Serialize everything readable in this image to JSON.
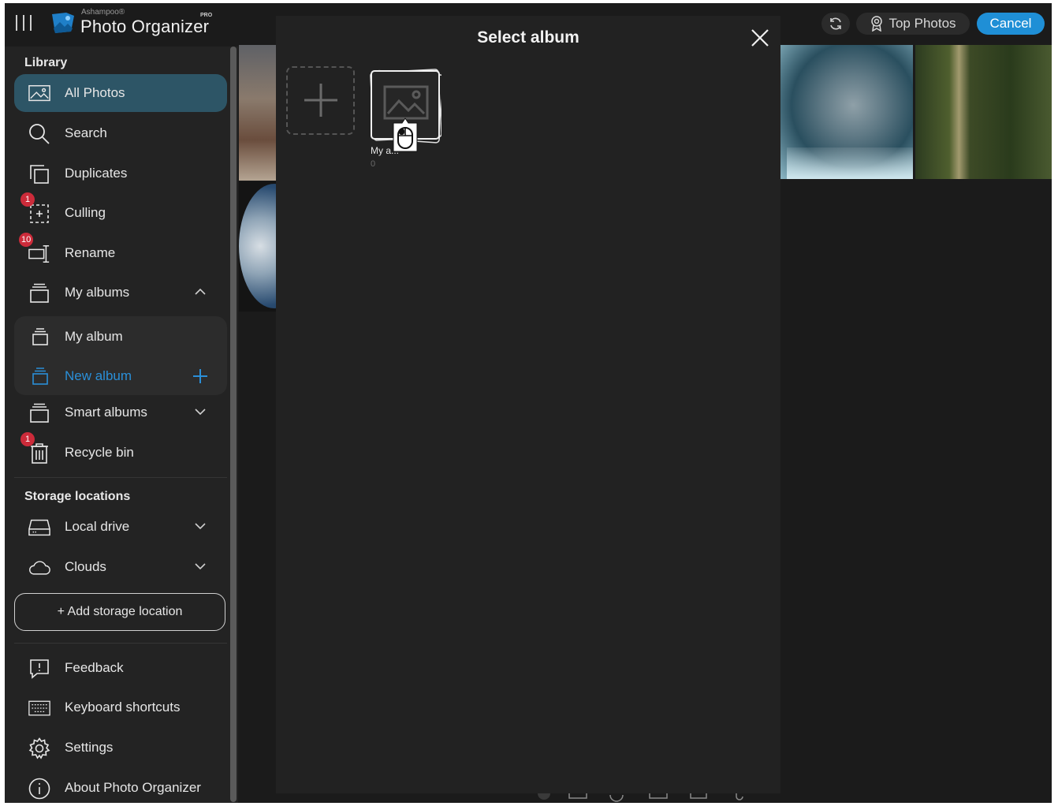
{
  "app": {
    "brand_small": "Ashampoo®",
    "brand_name": "Photo Organizer",
    "edition": "PRO"
  },
  "header": {
    "top_photos_label": "Top Photos",
    "cancel_label": "Cancel"
  },
  "sidebar": {
    "library_title": "Library",
    "items": [
      {
        "label": "All Photos",
        "icon": "photos-icon",
        "active": true
      },
      {
        "label": "Search",
        "icon": "search-icon"
      },
      {
        "label": "Duplicates",
        "icon": "duplicates-icon"
      },
      {
        "label": "Culling",
        "icon": "culling-icon",
        "badge": "1"
      },
      {
        "label": "Rename",
        "icon": "rename-icon",
        "badge": "10"
      },
      {
        "label": "My albums",
        "icon": "album-icon",
        "expanded": true
      }
    ],
    "albums": [
      {
        "label": "My album"
      },
      {
        "label": "New album"
      }
    ],
    "smart_albums_label": "Smart albums",
    "recycle_bin_label": "Recycle bin",
    "recycle_bin_badge": "1",
    "storage_title": "Storage locations",
    "local_drive_label": "Local drive",
    "clouds_label": "Clouds",
    "add_storage_label": "+ Add storage location",
    "footer": [
      {
        "label": "Feedback",
        "icon": "feedback-icon"
      },
      {
        "label": "Keyboard shortcuts",
        "icon": "keyboard-icon"
      },
      {
        "label": "Settings",
        "icon": "gear-icon"
      },
      {
        "label": "About Photo Organizer",
        "icon": "info-icon"
      }
    ]
  },
  "modal": {
    "title": "Select album",
    "album": {
      "name": "My a...",
      "count": "0"
    }
  },
  "colors": {
    "accent": "#1f8fd6",
    "active_item_bg": "#2d5566",
    "new_album_color": "#2a8fd8",
    "badge": "#cc2b3a"
  }
}
